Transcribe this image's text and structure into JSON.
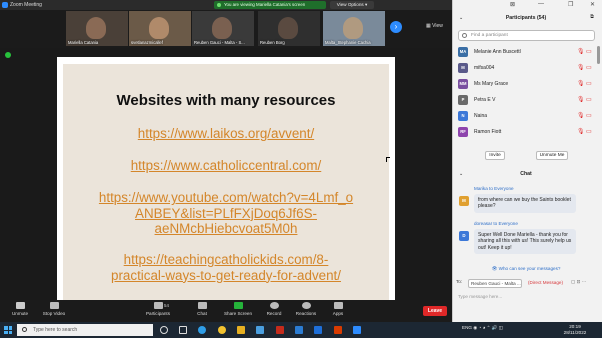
{
  "window": {
    "title": "Zoom Meeting"
  },
  "banner": {
    "text": "You are viewing Mariella Catania's screen"
  },
  "view_options": {
    "label": "View Options ▾"
  },
  "video_strip": {
    "participants": [
      {
        "name": "Mariella Catania"
      },
      {
        "name": "svetlanazmicallef"
      },
      {
        "name": "Reuben Gauci - Malta - S..."
      },
      {
        "name": "Reuben Borg"
      },
      {
        "name": "Malta_Stephanie Cachia"
      }
    ],
    "view_label": "View"
  },
  "slide": {
    "title": "Websites with many resources",
    "links": [
      [
        "https://www.laikos.org/avvent/"
      ],
      [
        "https://www.catholiccentral.com/"
      ],
      [
        "https://www.youtube.com/watch?v=4Lmf_o",
        "ANBEY&list=PLfFXjDoq6Jf6S-",
        "aeNMcbHiebcvoat5M0h"
      ],
      [
        "https://teachingcatholickids.com/8-",
        "practical-ways-to-get-ready-for-advent/"
      ]
    ]
  },
  "controls": {
    "unmute": "Unmute",
    "stop_video": "Stop Video",
    "participants": "Participants",
    "participants_count": "54",
    "chat": "Chat",
    "share_screen": "Share Screen",
    "record": "Record",
    "reactions": "Reactions",
    "apps": "Apps",
    "leave": "Leave"
  },
  "participants_panel": {
    "title": "Participants (54)",
    "search_placeholder": "Find a participant",
    "list": [
      {
        "initials": "MA",
        "name": "Melanie Ann Buscettl",
        "color": "#3a6ea5"
      },
      {
        "initials": "M",
        "name": "mifsa004",
        "color": "#5a5a8a"
      },
      {
        "initials": "MM",
        "name": "Ms Mary Grace",
        "color": "#7a4fa0"
      },
      {
        "initials": "P",
        "name": "Petra E V",
        "color": "#6a6a6a"
      },
      {
        "initials": "N",
        "name": "Naina",
        "color": "#3c78d8"
      },
      {
        "initials": "RF",
        "name": "Ramon Fiott",
        "color": "#8e44ad"
      }
    ],
    "invite": "Invite",
    "unmute_me": "Unmute Me"
  },
  "chat_panel": {
    "title": "Chat",
    "messages": [
      {
        "from": "Marika to Everyone",
        "initial": "M",
        "color": "#e0a030",
        "text": "from where can we buy the Saints booklet please?"
      },
      {
        "from": "doreasar to Everyone",
        "initial": "D",
        "color": "#3c78d8",
        "text": "Super Well Done Mariella - thank you for sharing all this with us! This surely help us out! Keep it up!"
      }
    ],
    "who_can_see": "Who can see your messages?",
    "to_label": "To:",
    "to_value": "Reuben Gauci - Malta ...",
    "direct": "(Direct Message)",
    "input_placeholder": "Type message here..."
  },
  "taskbar": {
    "search_placeholder": "Type here to search",
    "lang": "ENG",
    "time": "20:19",
    "date": "28/11/2022"
  },
  "colors": {
    "accent": "#2d8cff",
    "link": "#d4862a",
    "leave": "#e02828",
    "share": "#25b33a"
  }
}
